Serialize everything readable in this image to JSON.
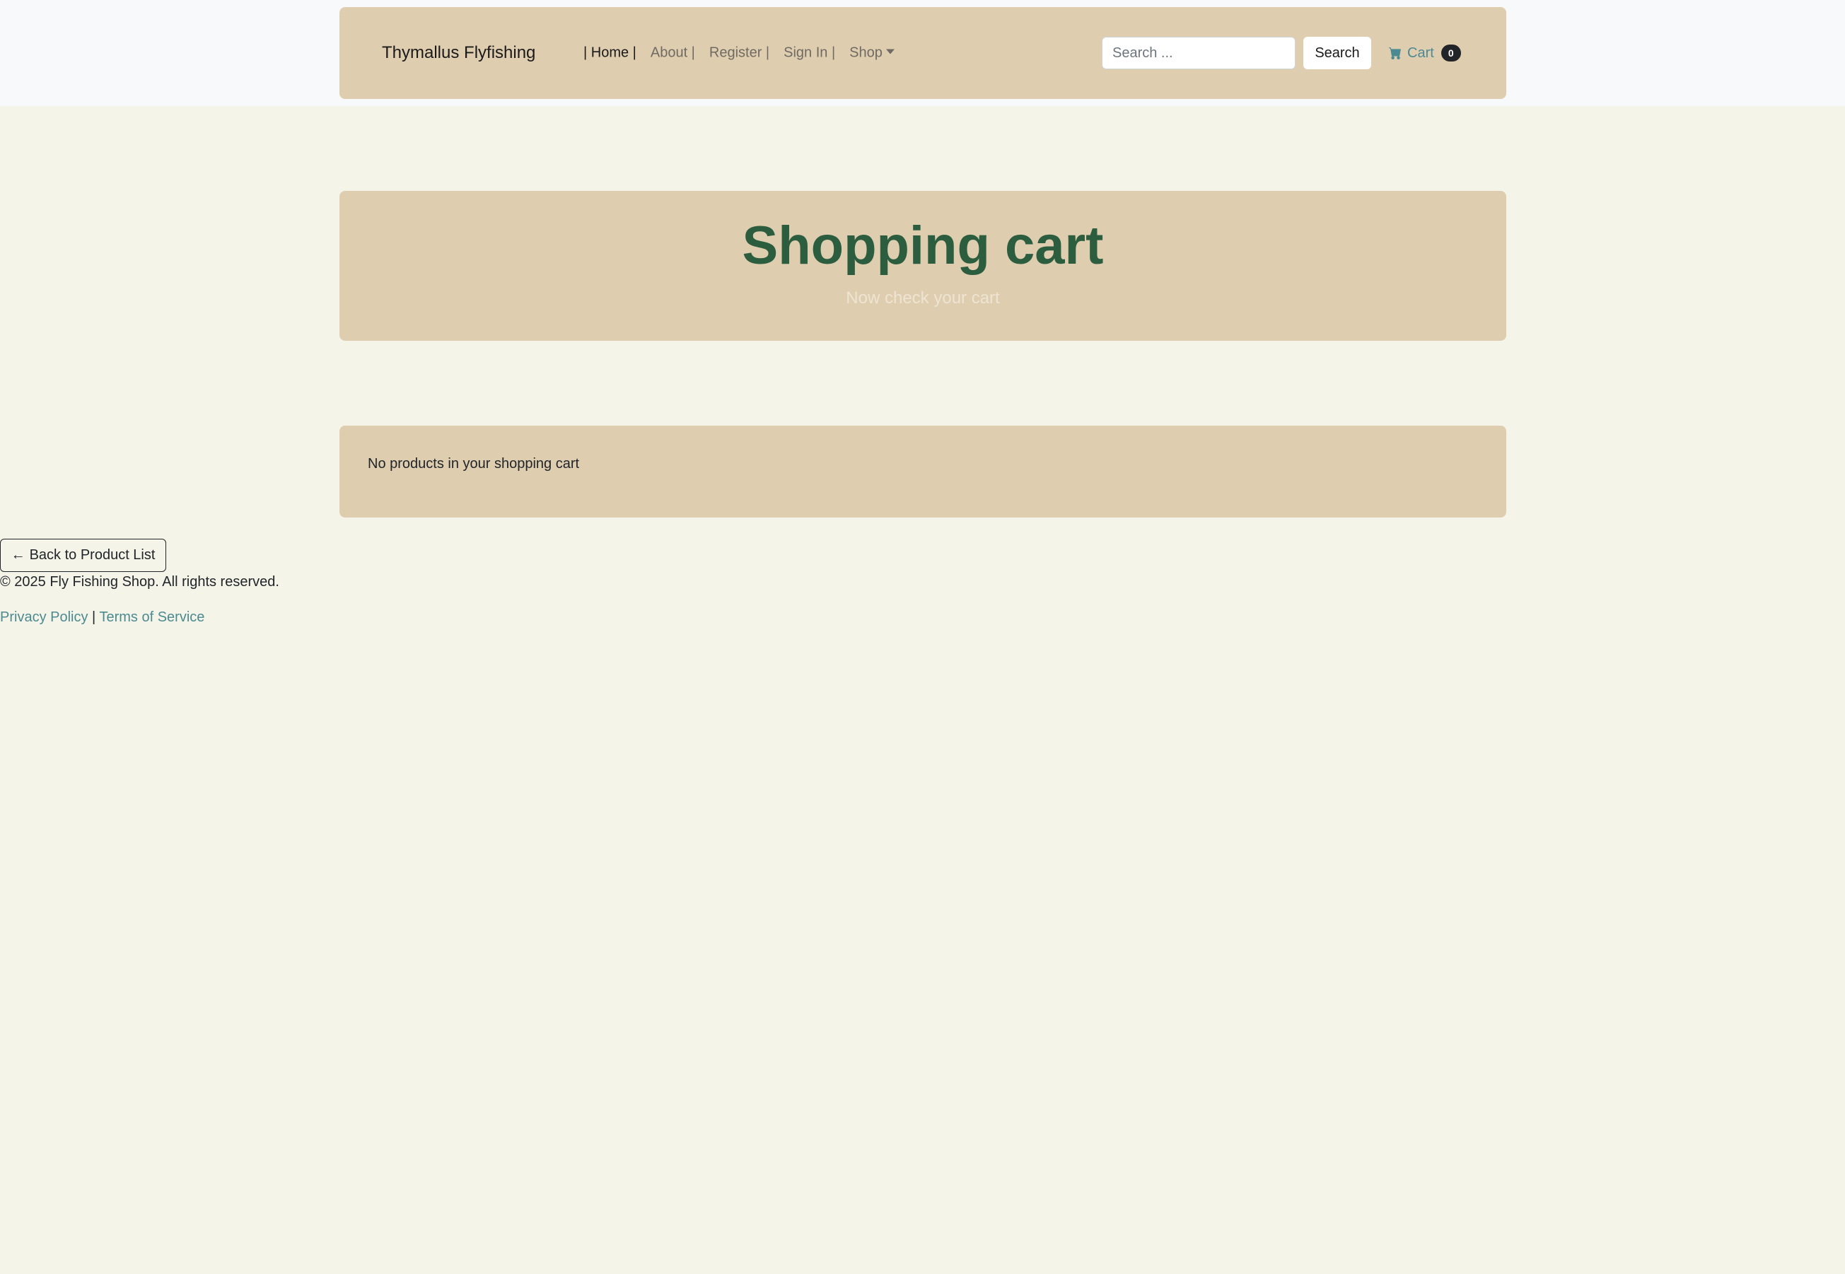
{
  "navbar": {
    "brand": "Thymallus Flyfishing",
    "links": [
      {
        "label": "| Home |",
        "active": true
      },
      {
        "label": "About |"
      },
      {
        "label": "Register |"
      },
      {
        "label": "Sign In |"
      },
      {
        "label": "Shop"
      }
    ],
    "search": {
      "placeholder": "Search ...",
      "value": "",
      "button_label": "Search"
    },
    "cart": {
      "label": "Cart",
      "count": "0",
      "icon": "shopping-cart-icon"
    }
  },
  "hero": {
    "title": "Shopping cart",
    "subtitle": "Now check your cart"
  },
  "cart_box": {
    "message": "No products in your shopping cart"
  },
  "back_button": {
    "arrow": "←",
    "label": "Back to Product List"
  },
  "footer": {
    "copyright": "© 2025 Fly Fishing Shop. All rights reserved.",
    "privacy": "Privacy Policy",
    "separator": "|",
    "terms": "Terms of Service"
  },
  "colors": {
    "page_background": "#f5f4e8",
    "panel_background": "#dfcdb0",
    "title_green": "#2b5d3e",
    "link_teal": "#4c8a92"
  }
}
